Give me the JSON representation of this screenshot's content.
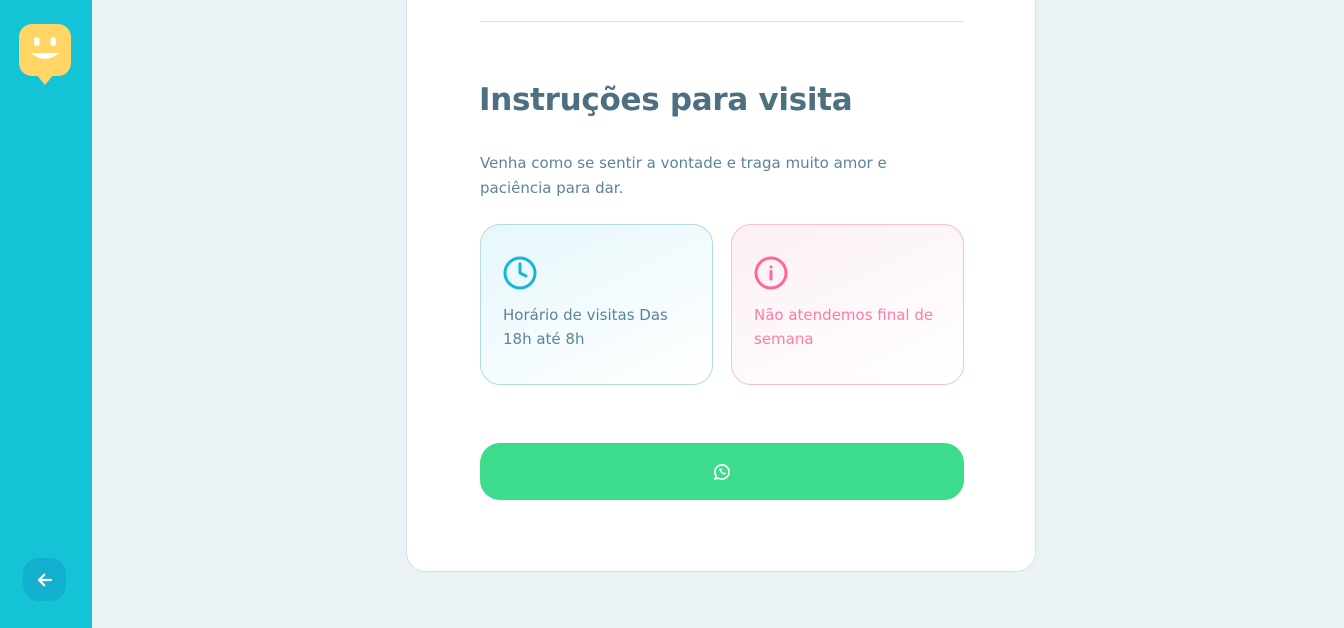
{
  "sidebar": {
    "logo_icon": "smiley-chat-bubble-icon",
    "back_icon": "arrow-left-icon",
    "colors": {
      "background": "#15c3d6",
      "back_button": "#12b0ce",
      "logo": "#ffd666"
    }
  },
  "main": {
    "title": "Instruções para visita",
    "description": "Venha como se sentir a vontade e traga muito amor e paciência para dar.",
    "hours": {
      "icon": "clock-icon",
      "text": "Horário de visitas Das 18h até 8h",
      "color": "#15b6d6"
    },
    "weekend": {
      "icon": "info-icon",
      "text": "Não atendemos final de semana",
      "color": "#ff669d"
    },
    "whatsapp_button": {
      "icon": "whatsapp-icon",
      "color": "#3cdc8c"
    }
  }
}
